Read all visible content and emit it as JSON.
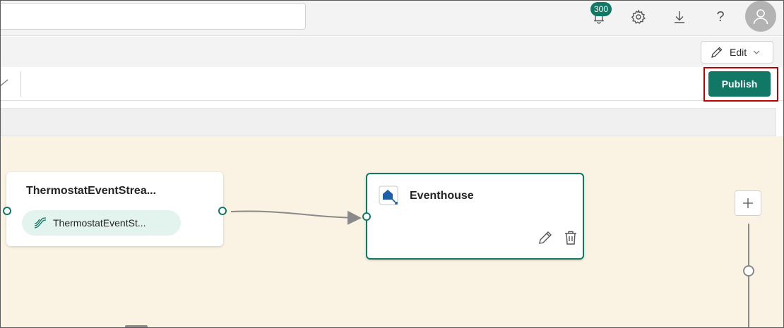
{
  "header": {
    "notification_count": "300",
    "icons": [
      "bell-icon",
      "gear-icon",
      "download-icon",
      "help-icon",
      "user-icon"
    ]
  },
  "ribbon": {
    "edit_label": "Edit"
  },
  "toolbar": {
    "publish_label": "Publish"
  },
  "canvas": {
    "source_node": {
      "title": "ThermostatEventStrea...",
      "stream_label": "ThermostatEventSt..."
    },
    "destination_node": {
      "title": "Eventhouse"
    }
  },
  "colors": {
    "accent": "#117865",
    "highlight": "#c00000",
    "canvas_bg": "#faf3e3",
    "pill_bg": "#e3f4ee"
  }
}
